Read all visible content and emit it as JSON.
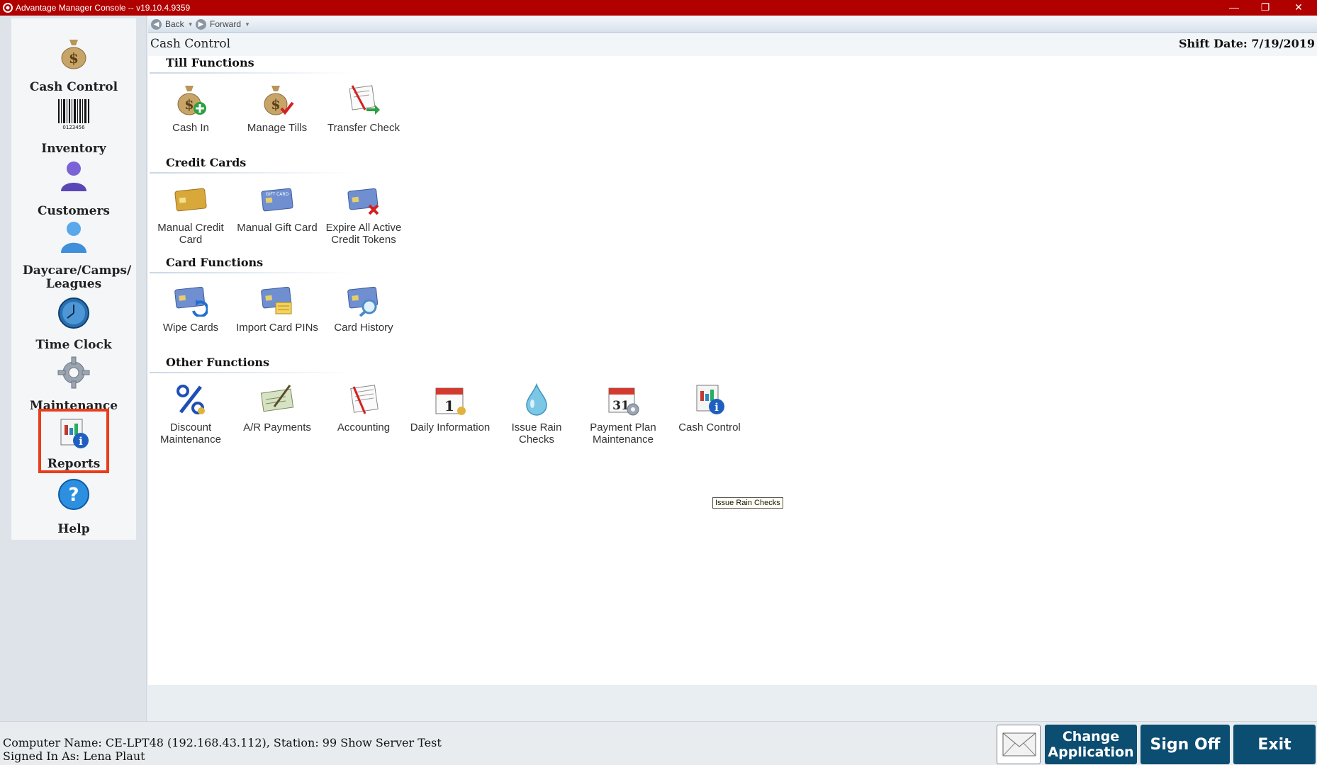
{
  "window": {
    "title": "Advantage Manager Console -- v19.10.4.9359",
    "controls": {
      "minimize": "—",
      "restore": "❐",
      "close": "✕"
    }
  },
  "navbar": {
    "back_label": "Back",
    "forward_label": "Forward"
  },
  "sidebar": {
    "items": [
      {
        "label": "Cash Control",
        "icon": "money-bag-icon"
      },
      {
        "label": "Inventory",
        "icon": "barcode-icon"
      },
      {
        "label": "Customers",
        "icon": "person-icon"
      },
      {
        "label": "Daycare/Camps/ Leagues",
        "icon": "person-blue-icon"
      },
      {
        "label": "Time Clock",
        "icon": "clock-icon"
      },
      {
        "label": "Maintenance",
        "icon": "gear-icon"
      },
      {
        "label": "Reports",
        "icon": "report-info-icon"
      },
      {
        "label": "Help",
        "icon": "help-icon"
      }
    ]
  },
  "header": {
    "title": "Cash Control",
    "shift_date": "Shift Date: 7/19/2019"
  },
  "sections": [
    {
      "title": "Till Functions",
      "items": [
        {
          "label": "Cash In",
          "icon": "cash-in-icon"
        },
        {
          "label": "Manage Tills",
          "icon": "manage-tills-icon"
        },
        {
          "label": "Transfer Check",
          "icon": "transfer-check-icon"
        }
      ]
    },
    {
      "title": "Credit Cards",
      "items": [
        {
          "label": "Manual Credit Card",
          "icon": "credit-card-icon"
        },
        {
          "label": "Manual Gift Card",
          "icon": "gift-card-icon"
        },
        {
          "label": "Expire All Active Credit Tokens",
          "icon": "expire-card-icon"
        }
      ]
    },
    {
      "title": "Card Functions",
      "items": [
        {
          "label": "Wipe Cards",
          "icon": "wipe-cards-icon"
        },
        {
          "label": "Import Card PINs",
          "icon": "import-pins-icon"
        },
        {
          "label": "Card History",
          "icon": "card-history-icon"
        }
      ]
    },
    {
      "title": "Other Functions",
      "items": [
        {
          "label": "Discount Maintenance",
          "icon": "percent-icon"
        },
        {
          "label": "A/R Payments",
          "icon": "check-pen-icon"
        },
        {
          "label": "Accounting",
          "icon": "accounting-icon"
        },
        {
          "label": "Daily Information",
          "icon": "calendar-1-icon"
        },
        {
          "label": "Issue Rain Checks",
          "icon": "raindrop-icon"
        },
        {
          "label": "Payment Plan Maintenance",
          "icon": "calendar-31-icon"
        },
        {
          "label": "Cash Control",
          "icon": "report-info-icon"
        }
      ]
    }
  ],
  "tooltip": "Issue Rain Checks",
  "footer": {
    "computer_line": "Computer Name: CE-LPT48 (192.168.43.112), Station: 99 Show Server Test",
    "signed_in_line": "Signed In As: Lena Plaut",
    "change_app_label": "Change Application",
    "sign_off_label": "Sign Off",
    "exit_label": "Exit"
  },
  "colors": {
    "titlebar": "#b00000",
    "button": "#0c4d72",
    "highlight": "#ea3d19"
  }
}
